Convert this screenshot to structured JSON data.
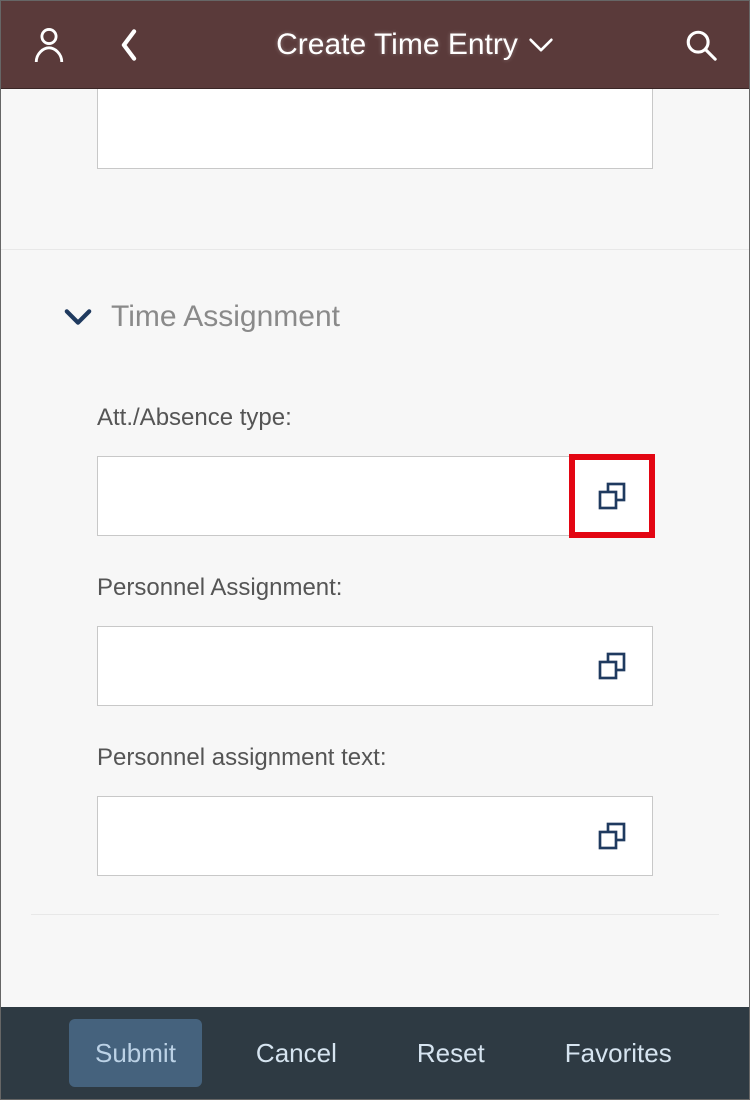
{
  "header": {
    "title": "Create Time Entry"
  },
  "section": {
    "title": "Time Assignment"
  },
  "fields": {
    "att_absence": {
      "label": "Att./Absence type:",
      "value": ""
    },
    "personnel_assignment": {
      "label": "Personnel Assignment:",
      "value": ""
    },
    "personnel_assignment_text": {
      "label": "Personnel assignment text:",
      "value": ""
    }
  },
  "footer": {
    "submit": "Submit",
    "cancel": "Cancel",
    "reset": "Reset",
    "favorites": "Favorites"
  },
  "colors": {
    "header_bg": "#5a3a3a",
    "accent_navy": "#1f3a5f",
    "highlight_red": "#e30613",
    "footer_bg": "#2e3a43"
  }
}
